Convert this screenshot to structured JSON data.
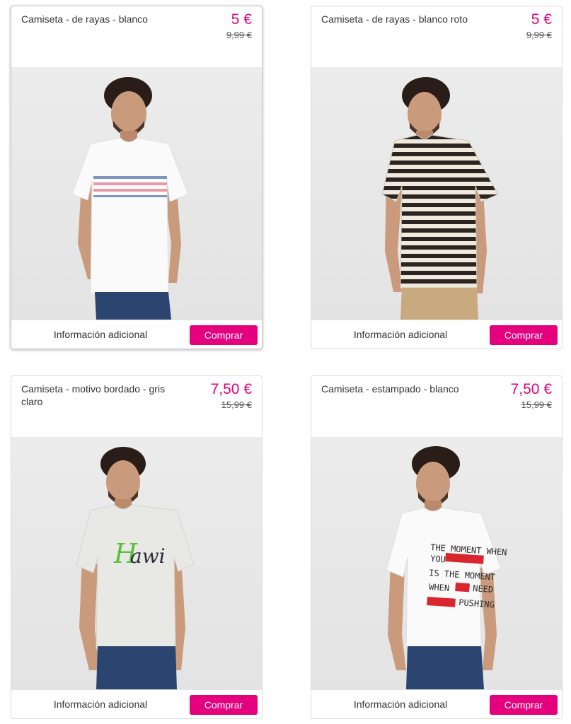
{
  "products": [
    {
      "title": "Camiseta - de rayas - blanco",
      "price": "5 €",
      "old_price": "9,99 €",
      "info_label": "Información adicional",
      "buy_label": "Comprar",
      "image_icon": "tshirt-white-stripes-photo"
    },
    {
      "title": "Camiseta - de rayas - blanco roto",
      "price": "5 €",
      "old_price": "9,99 €",
      "info_label": "Información adicional",
      "buy_label": "Comprar",
      "image_icon": "tshirt-black-stripes-photo"
    },
    {
      "title": "Camiseta - motivo bordado - gris claro",
      "price": "7,50 €",
      "old_price": "15,99 €",
      "info_label": "Información adicional",
      "buy_label": "Comprar",
      "image_icon": "tshirt-embroidered-grey-photo"
    },
    {
      "title": "Camiseta - estampado - blanco",
      "price": "7,50 €",
      "old_price": "15,99 €",
      "info_label": "Información adicional",
      "buy_label": "Comprar",
      "image_icon": "tshirt-printed-white-photo"
    }
  ],
  "photo_texts": {
    "hawi": "Hawi",
    "print_lines": [
      "THE MOMENT WHEN",
      "YOU",
      "IS THE MOMENT",
      "WHEN",
      "NEED",
      "PUSHING"
    ]
  },
  "colors": {
    "accent": "#e5007d",
    "jeans": "#2c4470",
    "skin": "#c99a7c",
    "hair": "#2a1d17"
  }
}
